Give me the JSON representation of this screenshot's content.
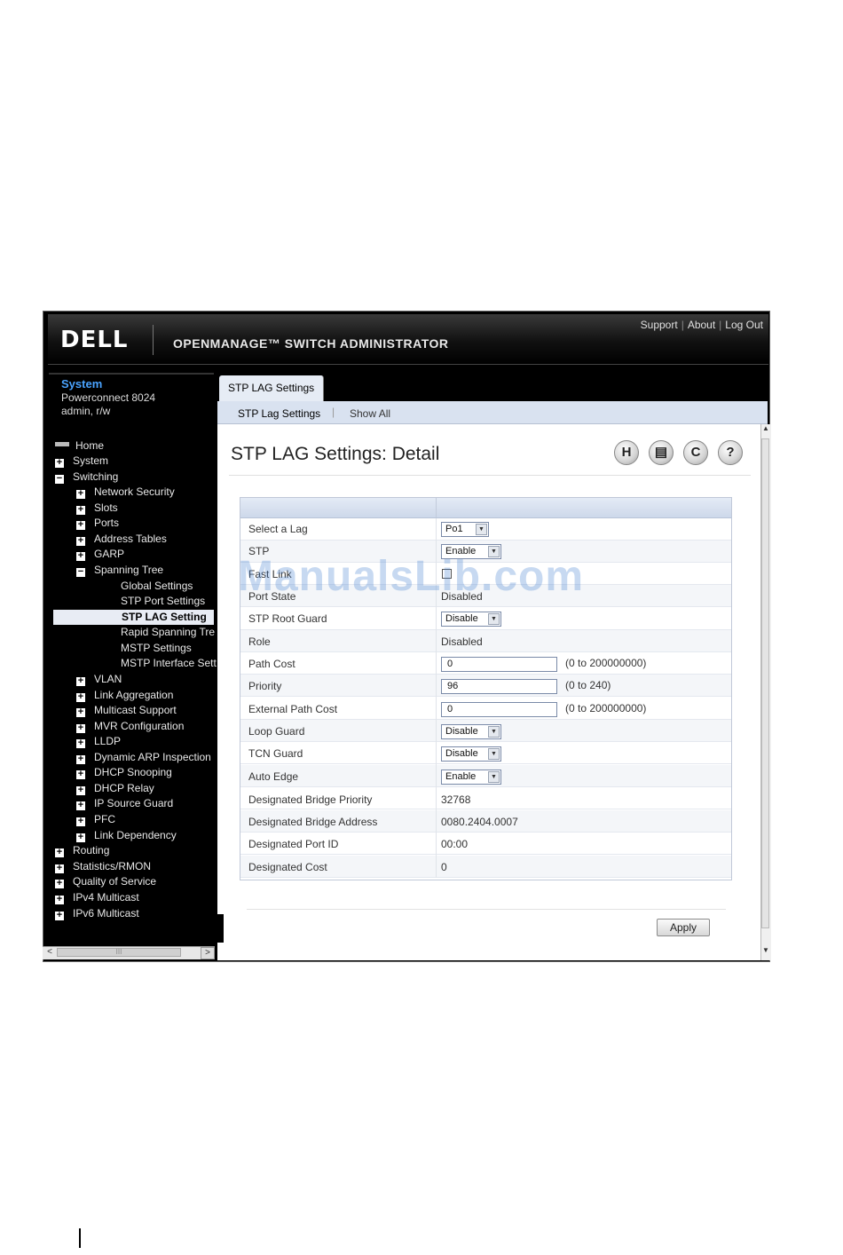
{
  "header": {
    "logo": "DELL",
    "app_title": "OPENMANAGE™ SWITCH ADMINISTRATOR",
    "links": [
      "Support",
      "About",
      "Log Out"
    ],
    "link_separator": "|"
  },
  "system_panel": {
    "title": "System",
    "model": "Powerconnect 8024",
    "user": "admin, r/w"
  },
  "nav": {
    "home": "Home",
    "system": "System",
    "switching": "Switching",
    "network_security": "Network Security",
    "slots": "Slots",
    "ports": "Ports",
    "address_tables": "Address Tables",
    "garp": "GARP",
    "spanning_tree": "Spanning Tree",
    "global_settings": "Global Settings",
    "stp_port_settings": "STP Port Settings",
    "stp_lag_settings": "STP LAG Setting",
    "rapid_spanning_tree": "Rapid Spanning Tre",
    "mstp_settings": "MSTP Settings",
    "mstp_interface_settings": "MSTP Interface Sett",
    "vlan": "VLAN",
    "link_aggregation": "Link Aggregation",
    "multicast_support": "Multicast Support",
    "mvr_configuration": "MVR Configuration",
    "lldp": "LLDP",
    "dynamic_arp_inspection": "Dynamic ARP Inspection",
    "dhcp_snooping": "DHCP Snooping",
    "dhcp_relay": "DHCP Relay",
    "ip_source_guard": "IP Source Guard",
    "pfc": "PFC",
    "link_dependency": "Link Dependency",
    "routing": "Routing",
    "statistics_rmon": "Statistics/RMON",
    "quality_of_service": "Quality of Service",
    "ipv4_multicast": "IPv4 Multicast",
    "ipv6_multicast": "IPv6 Multicast",
    "expand_symbol": "+",
    "collapse_symbol": "−"
  },
  "tabs": {
    "active": "STP LAG Settings",
    "sub": [
      "STP Lag Settings",
      "Show All"
    ],
    "sub_separator": "|"
  },
  "page": {
    "title": "STP LAG Settings: Detail",
    "toolbar_icons": {
      "save": "H",
      "print": "▤",
      "refresh": "C",
      "help": "?"
    }
  },
  "form": {
    "select_lag": {
      "label": "Select a Lag",
      "value": "Po1"
    },
    "stp": {
      "label": "STP",
      "value": "Enable"
    },
    "fast_link": {
      "label": "Fast Link",
      "checked": false
    },
    "port_state": {
      "label": "Port State",
      "value": "Disabled"
    },
    "stp_root_guard": {
      "label": "STP Root Guard",
      "value": "Disable"
    },
    "role": {
      "label": "Role",
      "value": "Disabled"
    },
    "path_cost": {
      "label": "Path Cost",
      "value": "0",
      "range": "(0 to 200000000)"
    },
    "priority": {
      "label": "Priority",
      "value": "96",
      "range": "(0 to 240)"
    },
    "external_path_cost": {
      "label": "External Path Cost",
      "value": "0",
      "range": "(0 to 200000000)"
    },
    "loop_guard": {
      "label": "Loop Guard",
      "value": "Disable"
    },
    "tcn_guard": {
      "label": "TCN Guard",
      "value": "Disable"
    },
    "auto_edge": {
      "label": "Auto Edge",
      "value": "Enable"
    },
    "designated_bridge_priority": {
      "label": "Designated Bridge Priority",
      "value": "32768"
    },
    "designated_bridge_address": {
      "label": "Designated Bridge Address",
      "value": "0080.2404.0007"
    },
    "designated_port_id": {
      "label": "Designated Port ID",
      "value": "00:00"
    },
    "designated_cost": {
      "label": "Designated Cost",
      "value": "0"
    }
  },
  "apply_label": "Apply",
  "watermark": "ManualsLib.com",
  "scroll_glyphs": {
    "up": "▲",
    "down": "▼",
    "left": "<",
    "right": ">",
    "grip": "III",
    "dropdown": "▼"
  }
}
